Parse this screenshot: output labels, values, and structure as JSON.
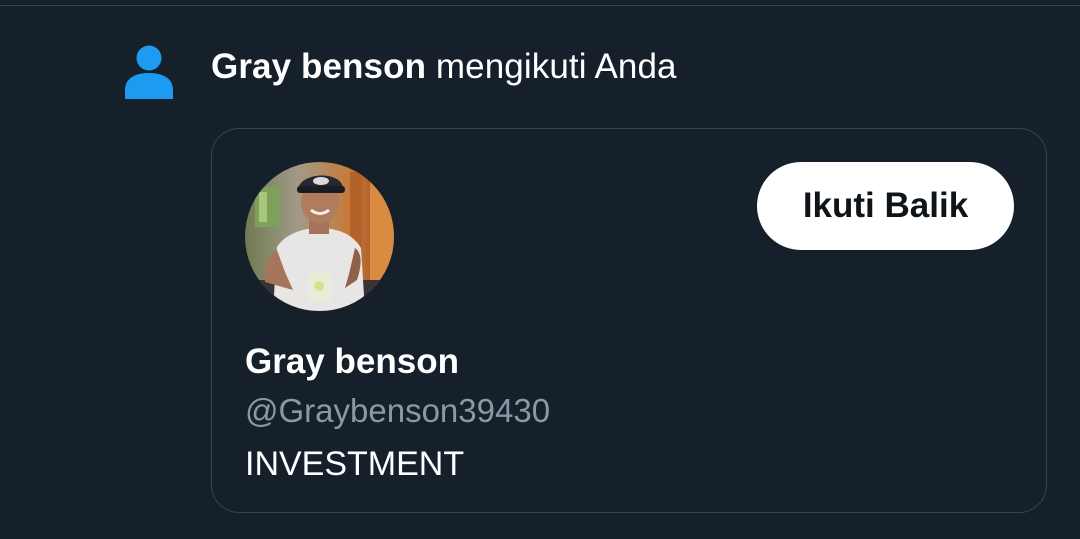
{
  "notification": {
    "icon": "person-icon",
    "name": "Gray benson",
    "action": " mengikuti Anda"
  },
  "profile_card": {
    "avatar": "profile-photo",
    "follow_back_label": "Ikuti Balik",
    "display_name": "Gray benson",
    "handle": "@Graybenson39430",
    "bio": "INVESTMENT"
  },
  "colors": {
    "background": "#15202b",
    "accent_blue": "#1d9bf0",
    "border": "#38444d",
    "secondary_text": "#8b98a5",
    "button_bg": "#ffffff",
    "button_text": "#0f1419"
  }
}
